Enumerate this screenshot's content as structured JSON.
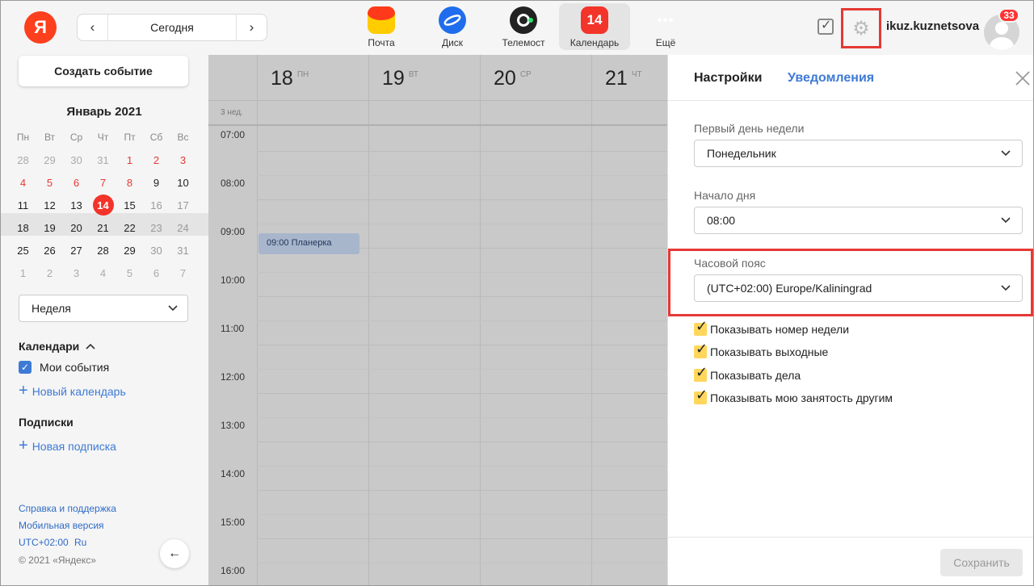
{
  "header": {
    "logo": "Я",
    "date_nav": {
      "prev": "‹",
      "today": "Сегодня",
      "next": "›"
    },
    "apps": [
      {
        "label": "Почта",
        "icon": "mail-icon",
        "text": ""
      },
      {
        "label": "Диск",
        "icon": "disk-icon",
        "text": ""
      },
      {
        "label": "Телемост",
        "icon": "telemost-icon",
        "text": ""
      },
      {
        "label": "Календарь",
        "icon": "calendar-icon",
        "text": "14"
      },
      {
        "label": "Ещё",
        "icon": "more-icon",
        "text": "•••"
      }
    ],
    "username": "ikuz.kuznetsova",
    "badge_count": "33"
  },
  "sidebar": {
    "create_button": "Создать событие",
    "month_title": "Январь 2021",
    "weekdays": [
      "Пн",
      "Вт",
      "Ср",
      "Чт",
      "Пт",
      "Сб",
      "Вс"
    ],
    "weeks": [
      [
        "28",
        "29",
        "30",
        "31",
        "1",
        "2",
        "3"
      ],
      [
        "4",
        "5",
        "6",
        "7",
        "8",
        "9",
        "10"
      ],
      [
        "11",
        "12",
        "13",
        "14",
        "15",
        "16",
        "17"
      ],
      [
        "18",
        "19",
        "20",
        "21",
        "22",
        "23",
        "24"
      ],
      [
        "25",
        "26",
        "27",
        "28",
        "29",
        "30",
        "31"
      ],
      [
        "1",
        "2",
        "3",
        "4",
        "5",
        "6",
        "7"
      ]
    ],
    "view_select": "Неделя",
    "calendars_title": "Календари",
    "my_events": "Мои события",
    "new_calendar": "Новый календарь",
    "subscriptions_title": "Подписки",
    "new_subscription": "Новая подписка",
    "help_link": "Справка и поддержка",
    "mobile_link": "Мобильная версия",
    "timezone_link": "UTC+02:00",
    "lang_link": "Ru",
    "copyright": "© 2021 «Яндекс»"
  },
  "grid": {
    "days": [
      {
        "num": "18",
        "wd": "ПН"
      },
      {
        "num": "19",
        "wd": "ВТ"
      },
      {
        "num": "20",
        "wd": "СР"
      },
      {
        "num": "21",
        "wd": "ЧТ"
      }
    ],
    "week_label": "3 нед.",
    "hours": [
      "07:00",
      "08:00",
      "09:00",
      "10:00",
      "11:00",
      "12:00",
      "13:00",
      "14:00",
      "15:00",
      "16:00"
    ],
    "event": "09:00 Планерка"
  },
  "settings": {
    "tab_settings": "Настройки",
    "tab_notifications": "Уведомления",
    "first_day_label": "Первый день недели",
    "first_day_value": "Понедельник",
    "day_start_label": "Начало дня",
    "day_start_value": "08:00",
    "timezone_label": "Часовой пояс",
    "timezone_value": "(UTC+02:00) Europe/Kaliningrad",
    "checkboxes": [
      "Показывать номер недели",
      "Показывать выходные",
      "Показывать дела",
      "Показывать мою занятость другим"
    ],
    "save_button": "Сохранить"
  },
  "colors": {
    "accent_red": "#f3342a",
    "link_blue": "#3d7ad6",
    "highlight": "#e53935",
    "overlay_gray": "#c9c9c9"
  }
}
